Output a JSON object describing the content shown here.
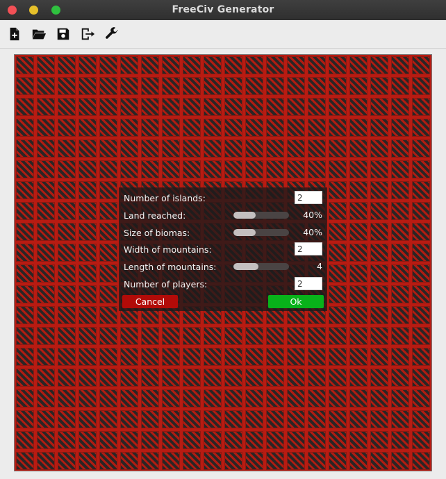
{
  "window": {
    "title": "FreeCiv Generator"
  },
  "toolbar": {
    "items": [
      {
        "icon": "new-file-icon"
      },
      {
        "icon": "open-folder-icon"
      },
      {
        "icon": "save-icon"
      },
      {
        "icon": "export-icon"
      },
      {
        "icon": "wrench-icon"
      }
    ]
  },
  "map": {
    "columns": 20,
    "rows": 20,
    "tile_color": "#2a2525",
    "stripe_color": "#b01c12"
  },
  "dialog": {
    "islands_label": "Number of islands:",
    "islands_value": "2",
    "land_label": "Land reached:",
    "land_percent": 40,
    "land_text": "40%",
    "biomas_label": "Size of biomas:",
    "biomas_percent": 40,
    "biomas_text": "40%",
    "mountain_width_label": "Width of mountains:",
    "mountain_width_value": "2",
    "mountain_length_label": "Length of mountains:",
    "mountain_length_level": 0.45,
    "mountain_length_text": "4",
    "players_label": "Number of players:",
    "players_value": "2",
    "cancel_label": "Cancel",
    "ok_label": "Ok",
    "cancel_color": "#b20b08",
    "ok_color": "#08b21a"
  }
}
